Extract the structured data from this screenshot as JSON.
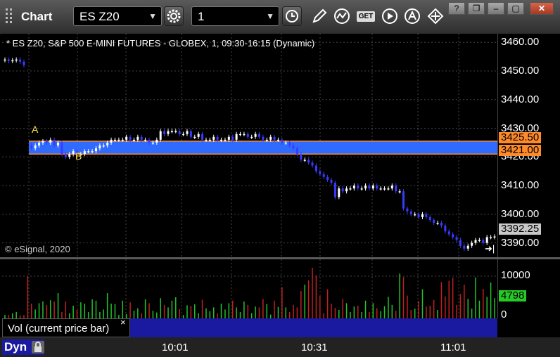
{
  "app": {
    "title": "Chart"
  },
  "toolbar": {
    "symbol": "ES Z20",
    "interval": "1",
    "get_label": "GET"
  },
  "chart_info": {
    "description": "* ES Z20, S&P 500 E-MINI FUTURES - GLOBEX, 1, 09:30-16:15 (Dynamic)",
    "copyright": "© eSignal, 2020",
    "marker_a": "A",
    "marker_b": "B"
  },
  "price_axis": {
    "ticks": [
      "3460.00",
      "3450.00",
      "3440.00",
      "3430.00",
      "3420.00",
      "3410.00",
      "3400.00",
      "3390.00"
    ],
    "label_high": "3425.50",
    "label_low": "3421.00",
    "label_last": "3392.25"
  },
  "volume_axis": {
    "ticks": [
      "10000",
      "0"
    ],
    "label_current": "4798"
  },
  "study": {
    "label": "Vol (current price bar)",
    "close": "×"
  },
  "bottom": {
    "mode": "Dyn"
  },
  "time_axis": {
    "ticks": [
      "10:01",
      "10:31",
      "11:01"
    ]
  },
  "colors": {
    "band": "#2f6bff",
    "band_edge": "#ff8a2a",
    "up_candle": "#ffffff",
    "down_candle": "#3a3aff",
    "vol_up": "#22c22a",
    "vol_down": "#c02020"
  },
  "chart_data": {
    "type": "candlestick",
    "y_range": [
      3385,
      3463
    ],
    "volume_range": [
      0,
      14000
    ],
    "price_zone": {
      "high": 3425.5,
      "low": 3421.0
    },
    "last_price": 3392.25,
    "current_volume": 4798,
    "closes": [
      3454,
      3453.5,
      3453.75,
      3454,
      3453.25,
      3452,
      3424,
      3423,
      3424,
      3425,
      3425.5,
      3425,
      3426,
      3424,
      3425,
      3421,
      3420,
      3421,
      3422,
      3421,
      3421,
      3422,
      3422,
      3422,
      3423,
      3424,
      3424,
      3425,
      3426,
      3426,
      3426,
      3426,
      3427,
      3426,
      3426,
      3427,
      3426,
      3426,
      3425,
      3425,
      3426,
      3429,
      3428,
      3429,
      3429,
      3429,
      3428,
      3428,
      3429,
      3427,
      3427,
      3428,
      3426,
      3426,
      3426,
      3427,
      3426,
      3426,
      3426,
      3427,
      3426,
      3428,
      3428,
      3428,
      3427,
      3427,
      3428,
      3427,
      3426,
      3426,
      3427,
      3426,
      3426,
      3425,
      3425,
      3424,
      3423,
      3421,
      3419,
      3419,
      3418,
      3417,
      3415,
      3414,
      3413,
      3412,
      3411,
      3406,
      3409,
      3408,
      3409,
      3409,
      3410,
      3409,
      3409,
      3410,
      3409,
      3410,
      3409,
      3409,
      3409,
      3409,
      3410,
      3408,
      3408,
      3402,
      3401,
      3400,
      3400,
      3399,
      3400,
      3399,
      3398,
      3397,
      3397,
      3396,
      3394,
      3393,
      3392,
      3391,
      3389,
      3388,
      3389,
      3390,
      3391,
      3391,
      3390,
      3392,
      3392,
      3392.25
    ],
    "volumes": [
      800,
      800,
      1200,
      1500,
      700,
      800,
      10000,
      3500,
      2100,
      3600,
      4000,
      3200,
      4300,
      4000,
      6000,
      1500,
      4000,
      1200,
      3000,
      2000,
      3800,
      3500,
      1500,
      4500,
      4200,
      1500,
      2100,
      6000,
      3500,
      3400,
      800,
      4200,
      1000,
      3800,
      1800,
      2400,
      1200,
      4500,
      3600,
      1800,
      1400,
      4800,
      3200,
      2600,
      4200,
      5000,
      2200,
      800,
      3100,
      2900,
      3300,
      1200,
      4400,
      2400,
      1700,
      2600,
      1200,
      3500,
      2100,
      3600,
      4200,
      2600,
      1500,
      4000,
      3200,
      1200,
      2800,
      2600,
      4600,
      3400,
      900,
      4200,
      2700,
      7400,
      2600,
      1500,
      3200,
      2600,
      6500,
      8000,
      9000,
      12000,
      10200,
      5300,
      1200,
      6900,
      3500,
      2500,
      2000,
      4600,
      3600,
      1500,
      2800,
      3000,
      1500,
      4200,
      1500,
      3600,
      2400,
      1700,
      2900,
      5100,
      3200,
      1800,
      10600,
      9800,
      5400,
      2000,
      2300,
      4100,
      6900,
      2800,
      3000,
      4400,
      2000,
      8600,
      5200,
      8900,
      9600,
      3200,
      5800,
      8000,
      4600,
      2300,
      9700,
      4200,
      7000,
      5100,
      8500,
      4798
    ]
  }
}
